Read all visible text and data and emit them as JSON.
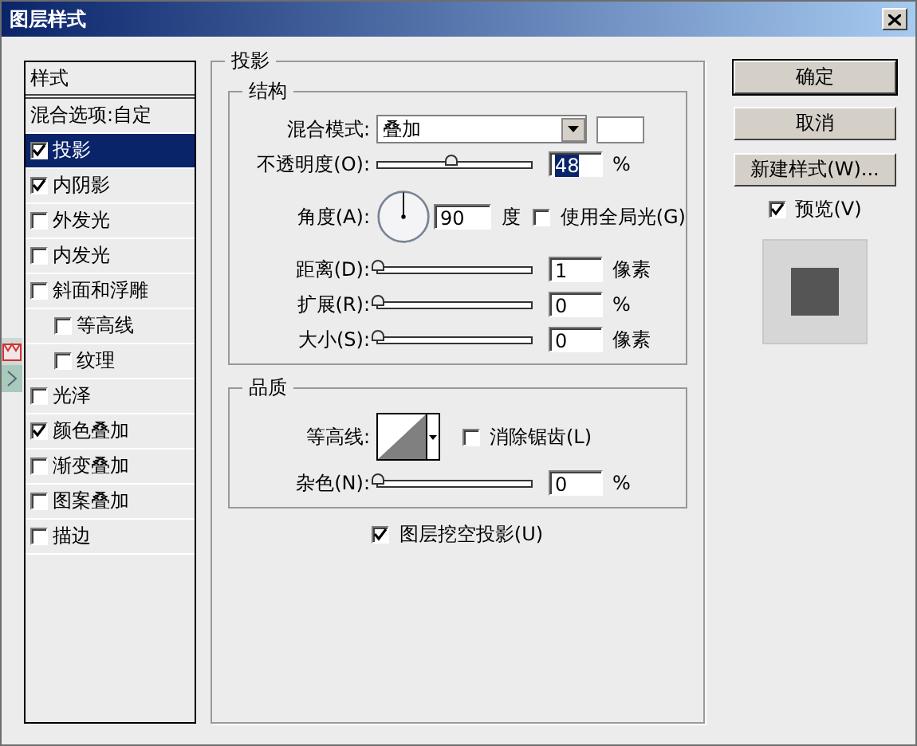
{
  "window": {
    "title": "图层样式"
  },
  "styles_list": {
    "header": "样式",
    "items": [
      {
        "label": "混合选项:自定",
        "kind": "plain",
        "selected": false
      },
      {
        "label": "投影",
        "kind": "check",
        "checked": true,
        "selected": true
      },
      {
        "label": "内阴影",
        "kind": "check",
        "checked": true,
        "selected": false
      },
      {
        "label": "外发光",
        "kind": "check",
        "checked": false,
        "selected": false
      },
      {
        "label": "内发光",
        "kind": "check",
        "checked": false,
        "selected": false
      },
      {
        "label": "斜面和浮雕",
        "kind": "check",
        "checked": false,
        "selected": false,
        "children": [
          {
            "label": "等高线",
            "kind": "check",
            "checked": false,
            "selected": false
          },
          {
            "label": "纹理",
            "kind": "check",
            "checked": false,
            "selected": false
          }
        ]
      },
      {
        "label": "光泽",
        "kind": "check",
        "checked": false,
        "selected": false
      },
      {
        "label": "颜色叠加",
        "kind": "check",
        "checked": true,
        "selected": false
      },
      {
        "label": "渐变叠加",
        "kind": "check",
        "checked": false,
        "selected": false
      },
      {
        "label": "图案叠加",
        "kind": "check",
        "checked": false,
        "selected": false
      },
      {
        "label": "描边",
        "kind": "check",
        "checked": false,
        "selected": false
      }
    ]
  },
  "panel": {
    "title": "投影",
    "structure": {
      "title": "结构",
      "blend_mode": {
        "label": "混合模式:",
        "value": "叠加"
      },
      "opacity": {
        "label": "不透明度(O):",
        "level": 0.48,
        "value": "48",
        "unit": "%"
      },
      "angle": {
        "label": "角度(A):",
        "value": "90",
        "unit": "度",
        "global_light": {
          "label": "使用全局光(G)",
          "checked": false
        }
      },
      "sliders": [
        {
          "label": "距离(D):",
          "level": 0.0,
          "value": "1",
          "unit": "像素"
        },
        {
          "label": "扩展(R):",
          "level": 0.0,
          "value": "0",
          "unit": "%"
        },
        {
          "label": "大小(S):",
          "level": 0.0,
          "value": "0",
          "unit": "像素"
        }
      ]
    },
    "quality": {
      "title": "品质",
      "contour_label": "等高线:",
      "anti_alias": {
        "label": "消除锯齿(L)",
        "checked": false
      },
      "noise": {
        "label": "杂色(N):",
        "level": 0.0,
        "value": "0",
        "unit": "%"
      }
    },
    "knockout": {
      "label": "图层挖空投影(U)",
      "checked": true
    }
  },
  "buttons": [
    "确定",
    "取消",
    "新建样式(W)..."
  ],
  "preview": {
    "label": "预览(V)",
    "checked": true
  }
}
